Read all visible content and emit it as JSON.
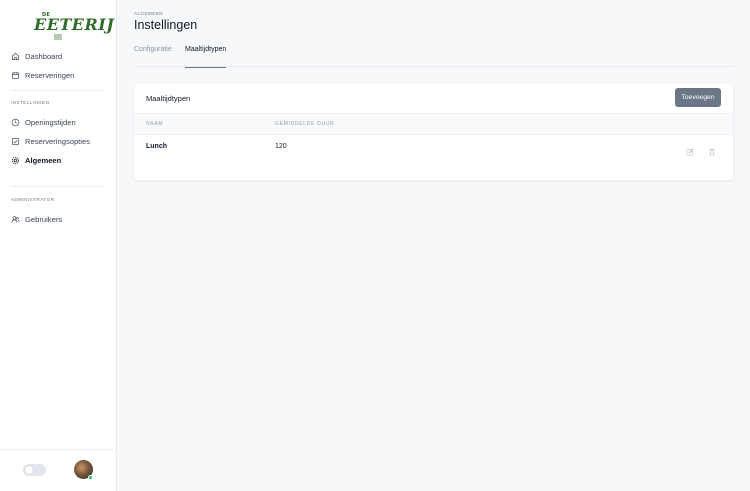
{
  "brand": {
    "small_text": "DE",
    "name": "EETERIJ",
    "color": "#2f6b2a"
  },
  "sidebar": {
    "items": [
      {
        "label": "Dashboard",
        "icon": "home-icon"
      },
      {
        "label": "Reserveringen",
        "icon": "calendar-icon"
      }
    ],
    "sections": [
      {
        "heading": "INSTELLINGEN",
        "items": [
          {
            "label": "Openingstijden",
            "icon": "clock-icon"
          },
          {
            "label": "Reserveringsopties",
            "icon": "checklist-icon"
          },
          {
            "label": "Algemeen",
            "icon": "gear-icon",
            "active": true
          }
        ]
      },
      {
        "heading": "ADMINISTRATOR",
        "items": [
          {
            "label": "Gebruikers",
            "icon": "users-icon"
          }
        ]
      }
    ],
    "footer": {
      "theme_toggle_on": false,
      "avatar_status_color": "#22c55e"
    }
  },
  "header": {
    "breadcrumb": "ALGEMEEN",
    "title": "Instellingen"
  },
  "tabs": [
    {
      "label": "Configuratie",
      "active": false
    },
    {
      "label": "Maaltijdtypen",
      "active": true
    }
  ],
  "card": {
    "title": "Maaltijdtypen",
    "add_button": "Toevoegen",
    "columns": [
      "NAAM",
      "GEMIDDELDE DUUR"
    ],
    "rows": [
      {
        "name": "Lunch",
        "duration": "120"
      }
    ]
  },
  "colors": {
    "button_bg": "#6b7686",
    "accent_text": "#111827",
    "muted_text": "#8e9aab"
  }
}
